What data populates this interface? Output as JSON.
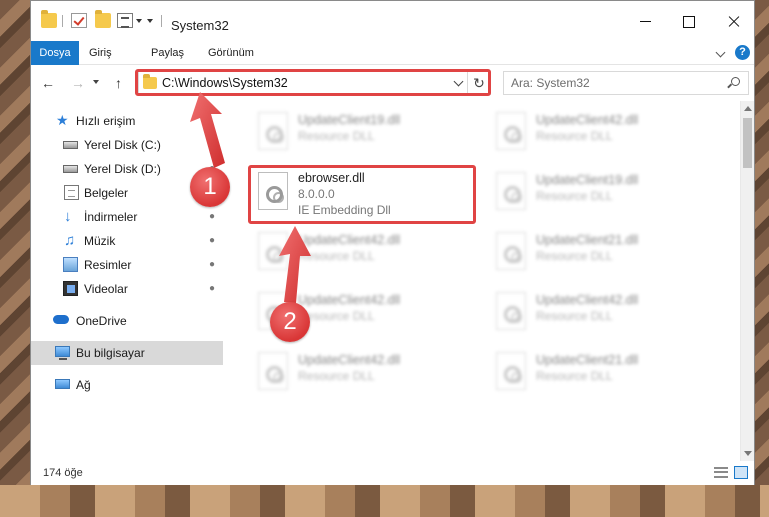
{
  "window": {
    "title": "System32",
    "tabs": [
      "Dosya",
      "Giriş",
      "Paylaş",
      "Görünüm"
    ],
    "help_label": "?"
  },
  "navigation": {
    "address": "C:\\Windows\\System32",
    "search_placeholder": "Ara: System32"
  },
  "sidebar": {
    "quick_access": "Hızlı erişim",
    "items": [
      {
        "label": "Yerel Disk (C:)",
        "icon": "disk-icon",
        "pinned": true
      },
      {
        "label": "Yerel Disk (D:)",
        "icon": "disk-icon",
        "pinned": true
      },
      {
        "label": "Belgeler",
        "icon": "document-icon",
        "pinned": true
      },
      {
        "label": "İndirmeler",
        "icon": "download-icon",
        "pinned": true
      },
      {
        "label": "Müzik",
        "icon": "music-icon",
        "pinned": true
      },
      {
        "label": "Resimler",
        "icon": "pictures-icon",
        "pinned": true
      },
      {
        "label": "Videolar",
        "icon": "videos-icon",
        "pinned": true
      }
    ],
    "onedrive": "OneDrive",
    "this_pc": "Bu bilgisayar",
    "network": "Ağ"
  },
  "files": {
    "highlighted": {
      "name": "ebrowser.dll",
      "version": "8.0.0.0",
      "description": "IE Embedding Dll"
    },
    "left_column": [
      {
        "name": "UpdateClient19.dll",
        "type": "Resource DLL"
      },
      {
        "name": "UpdateClient42.dll",
        "type": "Resource DLL"
      },
      {
        "name": "UpdateClient42.dll",
        "type": "Resource DLL"
      },
      {
        "name": "UpdateClient42.dll",
        "type": "Resource DLL"
      }
    ],
    "right_column": [
      {
        "name": "UpdateClient42.dll",
        "type": "Resource DLL"
      },
      {
        "name": "UpdateClient19.dll",
        "type": "Resource DLL"
      },
      {
        "name": "UpdateClient21.dll",
        "type": "Resource DLL"
      },
      {
        "name": "UpdateClient42.dll",
        "type": "Resource DLL"
      },
      {
        "name": "UpdateClient21.dll",
        "type": "Resource DLL"
      }
    ]
  },
  "status": {
    "item_count": "174 öğe"
  },
  "annotations": {
    "step1": "1",
    "step2": "2",
    "highlight_color": "#e04444"
  },
  "colors": {
    "accent": "#1979ca",
    "selection": "#d9d9d9"
  }
}
